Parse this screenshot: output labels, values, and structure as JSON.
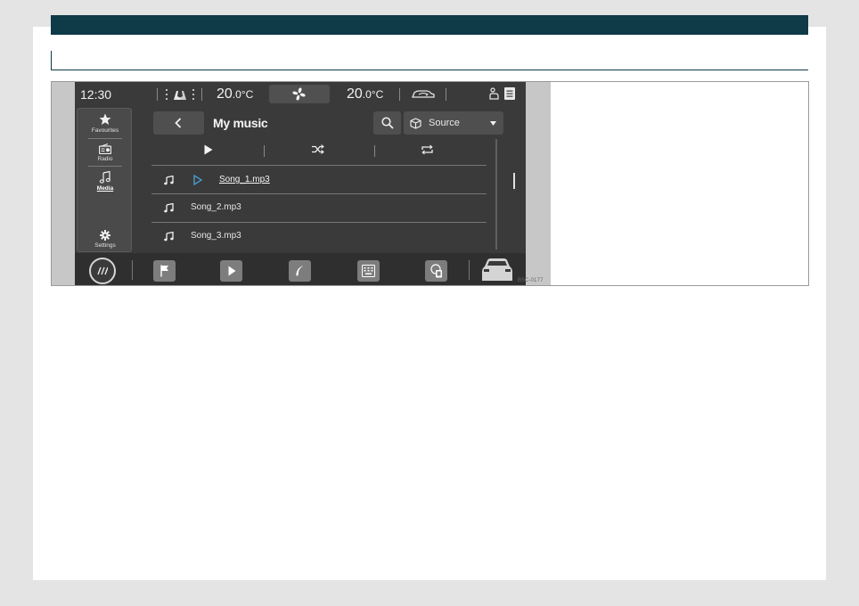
{
  "status_bar": {
    "time": "12:30",
    "left_temp_whole": "20",
    "left_temp_unit": ".0°C",
    "right_temp_whole": "20",
    "right_temp_unit": ".0°C",
    "icons": [
      "seat-heating-icon",
      "fan-icon",
      "recirculation-car-icon",
      "seat-icon",
      "menu-list-icon"
    ]
  },
  "side_menu": {
    "items": [
      {
        "label": "Favourites",
        "icon": "star-icon"
      },
      {
        "label": "Radio",
        "icon": "radio-icon"
      },
      {
        "label": "Media",
        "icon": "music-note-icon",
        "active": true
      },
      {
        "label": "Settings",
        "icon": "gear-icon"
      }
    ]
  },
  "header": {
    "title": "My music",
    "source_label": "Source"
  },
  "controls": [
    "play-icon",
    "shuffle-icon",
    "repeat-icon"
  ],
  "songs": [
    {
      "name": "Song_1.mp3",
      "playing": true
    },
    {
      "name": "Song_2.mp3",
      "playing": false
    },
    {
      "name": "Song_3.mp3",
      "playing": false
    }
  ],
  "dock": {
    "items": [
      "home-icon",
      "flag-icon",
      "play-icon",
      "phone-icon",
      "keyboard-screen-icon",
      "phone-app-icon",
      "car-icon"
    ]
  },
  "figure_code": "B5C-0177",
  "colors": {
    "brand_bar": "#0f3a47",
    "screen_bg": "#3a3a3a",
    "accent_play": "#4aa3d8"
  }
}
